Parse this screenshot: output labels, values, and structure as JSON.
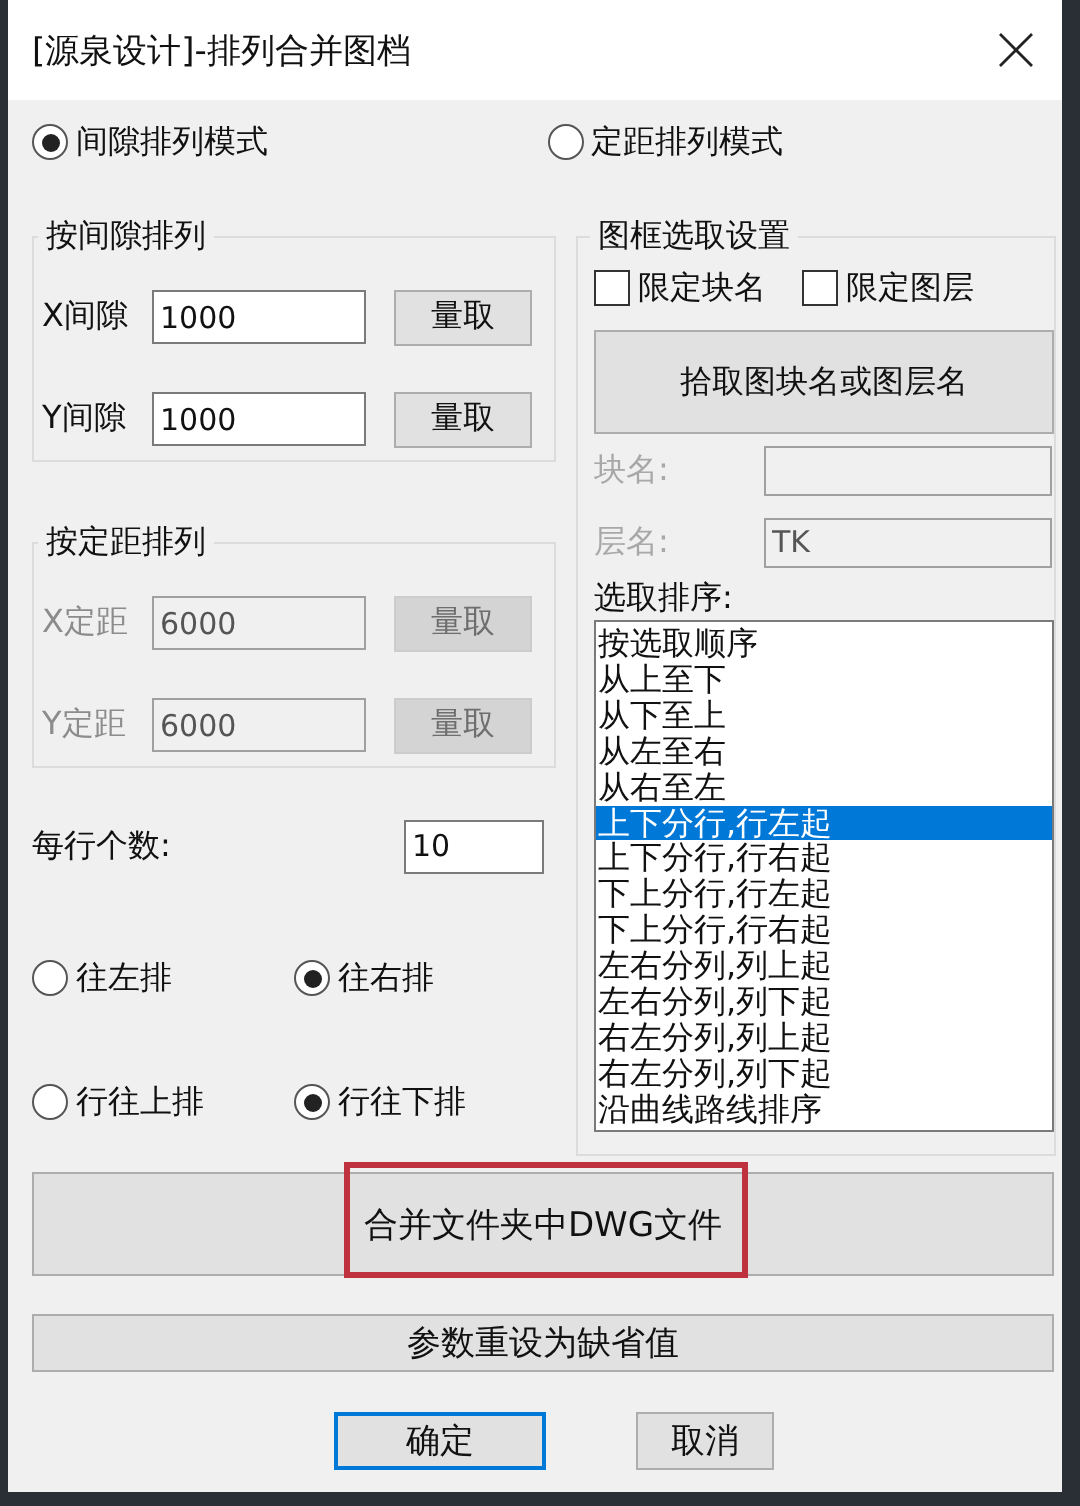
{
  "window": {
    "title": "[源泉设计]-排列合并图档"
  },
  "modes": [
    {
      "label": "间隙排列模式",
      "selected": true
    },
    {
      "label": "定距排列模式",
      "selected": false
    }
  ],
  "gap_group": {
    "title": "按间隙排列",
    "disabled": false,
    "rows": [
      {
        "label": "X间隙",
        "value": "1000",
        "button": "量取"
      },
      {
        "label": "Y间隙",
        "value": "1000",
        "button": "量取"
      }
    ]
  },
  "spacing_group": {
    "title": "按定距排列",
    "disabled": true,
    "rows": [
      {
        "label": "X定距",
        "value": "6000",
        "button": "量取"
      },
      {
        "label": "Y定距",
        "value": "6000",
        "button": "量取"
      }
    ]
  },
  "per_row": {
    "label": "每行个数:",
    "value": "10"
  },
  "horizontal": [
    {
      "label": "往左排",
      "selected": false
    },
    {
      "label": "往右排",
      "selected": true
    }
  ],
  "vertical": [
    {
      "label": "行往上排",
      "selected": false
    },
    {
      "label": "行往下排",
      "selected": true
    }
  ],
  "frame_settings": {
    "title": "图框选取设置",
    "checkboxes": [
      {
        "label": "限定块名",
        "checked": false
      },
      {
        "label": "限定图层",
        "checked": false
      }
    ],
    "pick_button": "拾取图块名或图层名",
    "fields": [
      {
        "label": "块名:",
        "disabled": true
      },
      {
        "label": "层名:",
        "value": "TK",
        "disabled": true
      }
    ]
  },
  "sort": {
    "label": "选取排序:",
    "items": [
      {
        "label": "按选取顺序",
        "selected": false
      },
      {
        "label": "从上至下",
        "selected": false
      },
      {
        "label": "从下至上",
        "selected": false
      },
      {
        "label": "从左至右",
        "selected": false
      },
      {
        "label": "从右至左",
        "selected": false
      },
      {
        "label": "上下分行,行左起",
        "selected": true
      },
      {
        "label": "上下分行,行右起",
        "selected": false
      },
      {
        "label": "下上分行,行左起",
        "selected": false
      },
      {
        "label": "下上分行,行右起",
        "selected": false
      },
      {
        "label": "左右分列,列上起",
        "selected": false
      },
      {
        "label": "左右分列,列下起",
        "selected": false
      },
      {
        "label": "右左分列,列上起",
        "selected": false
      },
      {
        "label": "右左分列,列下起",
        "selected": false
      },
      {
        "label": "沿曲线路线排序",
        "selected": false
      }
    ]
  },
  "merge_button": {
    "label": "合并文件夹中DWG文件",
    "highlighted": true
  },
  "reset_button": "参数重设为缺省值",
  "buttons": [
    {
      "label": "确定",
      "default": true
    },
    {
      "label": "取消",
      "default": false
    }
  ]
}
